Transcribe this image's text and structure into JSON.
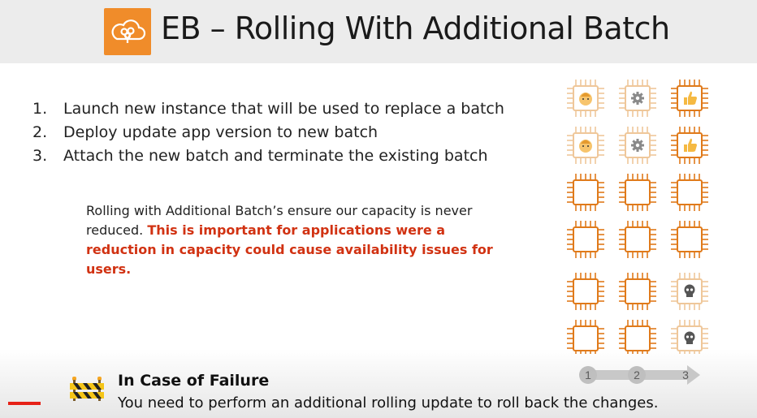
{
  "header": {
    "title": "EB – Rolling With Additional Batch",
    "logo_icon": "elastic-beanstalk-icon",
    "accent": "#f08c2a"
  },
  "steps": [
    {
      "num": "1.",
      "text": "Launch new instance that will be used to replace a batch"
    },
    {
      "num": "2.",
      "text": "Deploy update app version to new batch"
    },
    {
      "num": "3.",
      "text": "Attach the new batch and terminate the existing batch"
    }
  ],
  "note": {
    "plain": "Rolling with Additional Batch’s ensure our capacity is never reduced. ",
    "highlight": "This is important for applications were a reduction in capacity could cause availability issues for users.",
    "highlight_color": "#d13212"
  },
  "diagram": {
    "rows": [
      [
        "baby-face-icon",
        "gear-icon",
        "thumbs-up-icon"
      ],
      [
        "baby-face-icon",
        "gear-icon",
        "thumbs-up-icon"
      ],
      [
        "empty",
        "empty",
        "empty"
      ],
      [
        "empty",
        "empty",
        "empty"
      ],
      [
        "empty",
        "empty",
        "skull-icon"
      ],
      [
        "empty",
        "empty",
        "skull-icon"
      ]
    ],
    "arrow_labels": [
      "1",
      "2",
      "3"
    ],
    "chip_color": "#e07a1a"
  },
  "failure": {
    "title": "In Case of Failure",
    "text": "You need to perform an additional rolling update to roll back the changes.",
    "icon": "construction-barrier-icon"
  }
}
